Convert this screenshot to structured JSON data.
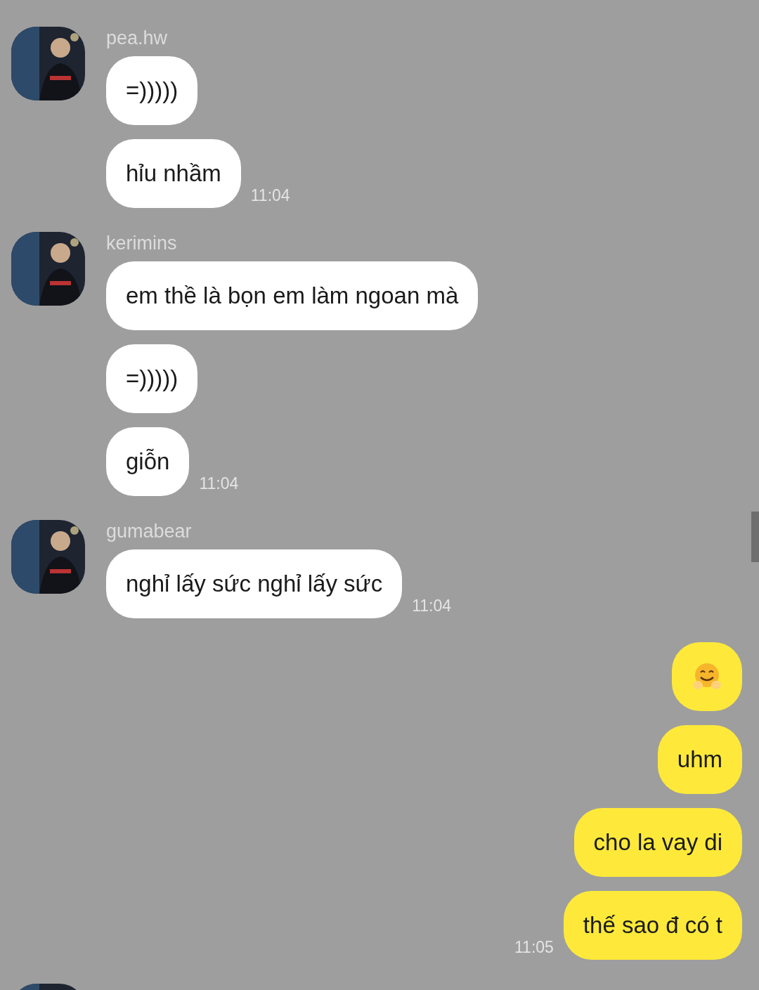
{
  "messages_groups": [
    {
      "kind": "incoming",
      "sender": "pea.hw",
      "avatar": {
        "kind": "picture"
      },
      "messages": [
        {
          "kind": "text",
          "text": "=)))))"
        },
        {
          "kind": "text",
          "text": "hỉu nhầm"
        }
      ],
      "time": "11:04"
    },
    {
      "kind": "incoming",
      "sender": "kerimins",
      "avatar": {
        "kind": "picture"
      },
      "messages": [
        {
          "kind": "text",
          "text": "em thề là bọn em làm ngoan mà"
        },
        {
          "kind": "text",
          "text": "=)))))"
        },
        {
          "kind": "text",
          "text": "giỗn"
        }
      ],
      "time": "11:04"
    },
    {
      "kind": "incoming",
      "sender": "gumabear",
      "avatar": {
        "kind": "picture"
      },
      "messages": [
        {
          "kind": "text",
          "text": "nghỉ lấy sức nghỉ lấy sức"
        }
      ],
      "time": "11:04"
    },
    {
      "kind": "outgoing",
      "messages": [
        {
          "kind": "emoji"
        },
        {
          "kind": "text",
          "text": "uhm"
        },
        {
          "kind": "text",
          "text": "cho la vay di"
        },
        {
          "kind": "text",
          "text": "thế sao đ có t"
        }
      ],
      "time": "11:05"
    },
    {
      "kind": "incoming",
      "avatar": {
        "kind": "picture"
      }
    }
  ]
}
